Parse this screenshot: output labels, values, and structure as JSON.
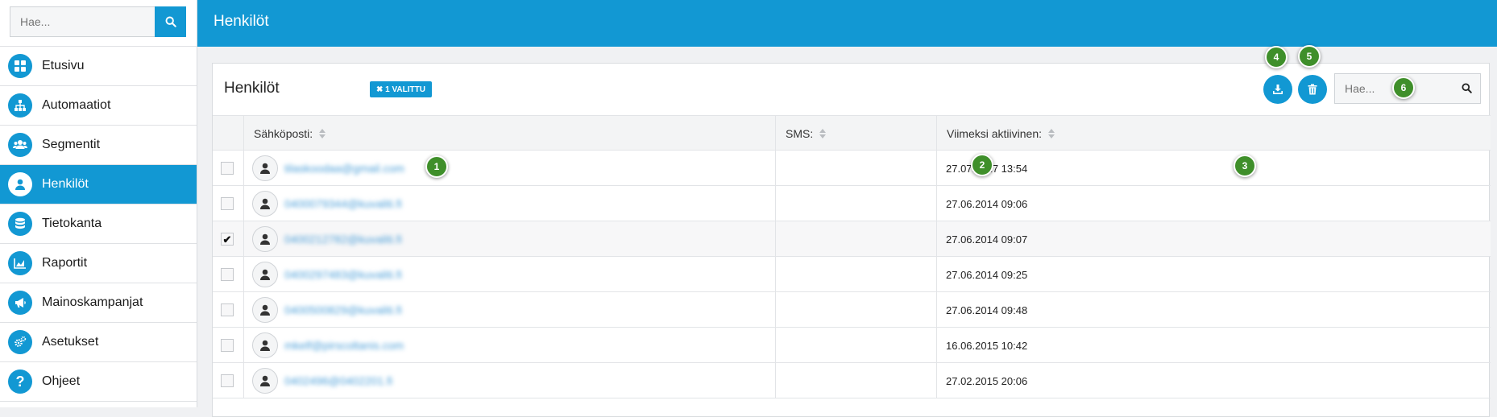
{
  "sidebar": {
    "search_placeholder": "Hae...",
    "items": [
      {
        "label": "Etusivu",
        "icon": "dashboard-icon"
      },
      {
        "label": "Automaatiot",
        "icon": "sitemap-icon"
      },
      {
        "label": "Segmentit",
        "icon": "users-icon"
      },
      {
        "label": "Henkilöt",
        "icon": "user-icon",
        "active": true
      },
      {
        "label": "Tietokanta",
        "icon": "database-icon"
      },
      {
        "label": "Raportit",
        "icon": "chart-icon"
      },
      {
        "label": "Mainoskampanjat",
        "icon": "megaphone-icon"
      },
      {
        "label": "Asetukset",
        "icon": "cogs-icon"
      },
      {
        "label": "Ohjeet",
        "icon": "help-icon"
      }
    ]
  },
  "header": {
    "title": "Henkilöt"
  },
  "panel": {
    "title": "Henkilöt",
    "badge": "✖ 1 VALITTU",
    "search_placeholder": "Hae...",
    "columns": {
      "email": "Sähköposti:",
      "sms": "SMS:",
      "last_active": "Viimeksi aktiivinen:"
    },
    "rows": [
      {
        "email": "tilaskoodaa@gmail.com",
        "sms": "",
        "last_active": "27.07.2017 13:54",
        "checked": false
      },
      {
        "email": "0400079344@kuvaliti.fi",
        "sms": "",
        "last_active": "27.06.2014 09:06",
        "checked": false
      },
      {
        "email": "0400212782@kuvaliti.fi",
        "sms": "",
        "last_active": "27.06.2014 09:07",
        "checked": true
      },
      {
        "email": "0400297483@kuvaliti.fi",
        "sms": "",
        "last_active": "27.06.2014 09:25",
        "checked": false
      },
      {
        "email": "0400500829@kuvaliti.fi",
        "sms": "",
        "last_active": "27.06.2014 09:48",
        "checked": false
      },
      {
        "email": "mkelf@pirscoltanis.com",
        "sms": "",
        "last_active": "16.06.2015 10:42",
        "checked": false
      },
      {
        "email": "0402496@0402201.fi",
        "sms": "",
        "last_active": "27.02.2015 20:06",
        "checked": false
      }
    ]
  },
  "markers": [
    "1",
    "2",
    "3",
    "4",
    "5",
    "6"
  ],
  "colors": {
    "accent": "#1298d3",
    "marker": "#3f8f2a"
  }
}
